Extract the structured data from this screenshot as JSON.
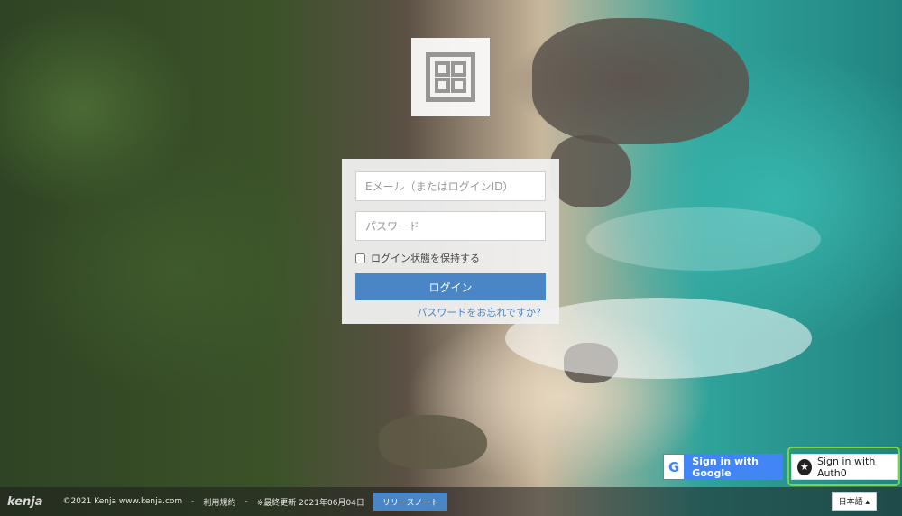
{
  "login": {
    "email_placeholder": "Eメール（またはログインID）",
    "password_placeholder": "パスワード",
    "remember_label": "ログイン状態を保持する",
    "login_button": "ログイン",
    "forgot_link": "パスワードをお忘れですか？"
  },
  "sso": {
    "google_label": "Sign in with Google",
    "google_glyph": "G",
    "auth0_label": "Sign in with Auth0",
    "auth0_glyph": "★"
  },
  "footer": {
    "brand": "kenja",
    "copyright": "©2021 Kenja www.kenja.com",
    "sep1": "-",
    "terms": "利用規約",
    "sep2": "-",
    "last_updated": "※最終更新 2021年06月04日",
    "release_notes": "リリースノート",
    "language": "日本語 ▴"
  },
  "colors": {
    "accent": "#4a86c5",
    "google": "#4285f4",
    "auth0_highlight": "#7ad24b"
  },
  "icons": {
    "logo": "kenja-grid-logo-icon",
    "google": "google-g-icon",
    "auth0": "auth0-star-icon"
  }
}
